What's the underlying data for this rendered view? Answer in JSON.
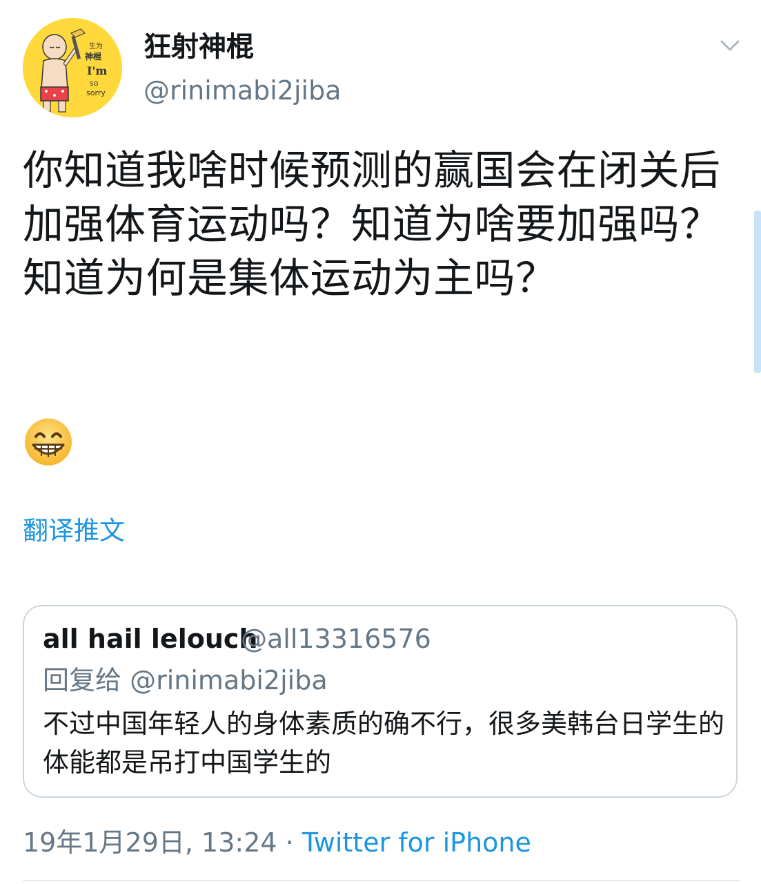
{
  "tweet": {
    "author": {
      "display_name": "狂射神棍",
      "handle": "@rinimabi2jiba",
      "avatar_text": [
        "生为",
        "神棍",
        "I'm",
        "so",
        "sorry"
      ]
    },
    "text": "你知道我啥时候预测的赢国会在闭关后加强体育运动吗？知道为啥要加强吗？\n知道为何是集体运动为主吗？",
    "emoji": "grinning-face-with-smiling-eyes",
    "translate_label": "翻译推文",
    "quoted_tweet": {
      "author_name": "all hail lelouch",
      "author_handle": "@all13316576",
      "reply_to_label": "回复给",
      "reply_to_handle": "@rinimabi2jiba",
      "text": "不过中国年轻人的身体素质的确不行，很多美韩台日学生的体能都是吊打中国学生的"
    },
    "timestamp": "19年1月29日, 13:24",
    "separator": "·",
    "source": "Twitter for iPhone"
  },
  "colors": {
    "text": "#14171a",
    "secondary": "#657786",
    "link": "#1b95e0",
    "border": "#ccd6dd",
    "avatar_bg": "#ffd93b"
  }
}
